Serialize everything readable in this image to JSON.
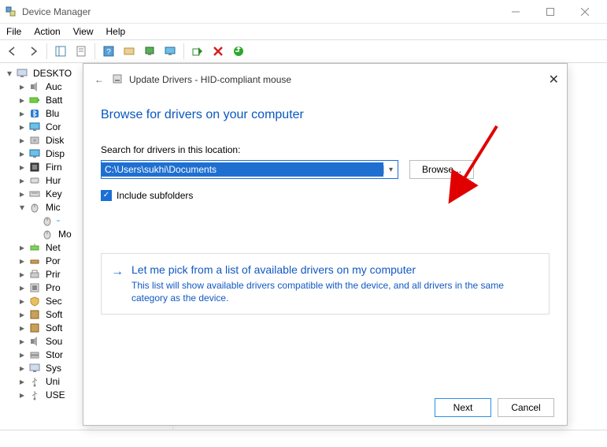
{
  "window": {
    "title": "Device Manager"
  },
  "menubar": [
    "File",
    "Action",
    "View",
    "Help"
  ],
  "tree": {
    "root": "DESKTO",
    "items": [
      {
        "label": "Auc"
      },
      {
        "label": "Batt"
      },
      {
        "label": "Blu"
      },
      {
        "label": "Cor"
      },
      {
        "label": "Disk"
      },
      {
        "label": "Disp"
      },
      {
        "label": "Firn"
      },
      {
        "label": "Hur"
      },
      {
        "label": "Key"
      },
      {
        "label": "Mic",
        "expanded": true,
        "children": [
          {
            "label": "",
            "selected": true
          },
          {
            "label": "Mo"
          }
        ]
      },
      {
        "label": "Net"
      },
      {
        "label": "Por"
      },
      {
        "label": "Prir"
      },
      {
        "label": "Pro"
      },
      {
        "label": "Sec"
      },
      {
        "label": "Soft"
      },
      {
        "label": "Soft"
      },
      {
        "label": "Sou"
      },
      {
        "label": "Stor"
      },
      {
        "label": "Sys"
      },
      {
        "label": "Uni"
      },
      {
        "label": "USE"
      }
    ]
  },
  "dialog": {
    "title": "Update Drivers - HID-compliant mouse",
    "heading": "Browse for drivers on your computer",
    "field_label": "Search for drivers in this location:",
    "path": "C:\\Users\\sukhi\\Documents",
    "browse_label": "Browse...",
    "include_label": "Include subfolders",
    "include_checked": true,
    "option": {
      "title": "Let me pick from a list of available drivers on my computer",
      "desc": "This list will show available drivers compatible with the device, and all drivers in the same category as the device."
    },
    "next_label": "Next",
    "cancel_label": "Cancel"
  }
}
